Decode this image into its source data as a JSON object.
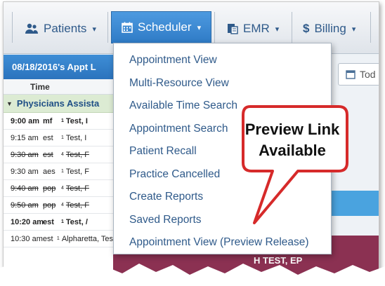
{
  "nav": {
    "items": [
      {
        "label": "Patients",
        "icon": "users-icon"
      },
      {
        "label": "Scheduler",
        "icon": "calendar-icon"
      },
      {
        "label": "EMR",
        "icon": "chart-icon"
      },
      {
        "label": "Billing",
        "icon": "dollar-icon"
      }
    ],
    "active": "Scheduler",
    "caret": "▾"
  },
  "schedule": {
    "header": "08/18/2016's Appt L",
    "column_time": "Time",
    "group": "Physicians Assista",
    "rows": [
      {
        "time": "9:00 am",
        "code": "mf",
        "sup": "1",
        "patient": "Test, I",
        "bold": true,
        "struck": false
      },
      {
        "time": "9:15 am",
        "code": "est",
        "sup": "1",
        "patient": "Test, I",
        "bold": false,
        "struck": false
      },
      {
        "time": "9:30 am",
        "code": "est",
        "sup": "4",
        "patient": "Test, F",
        "bold": false,
        "struck": true
      },
      {
        "time": "9:30 am",
        "code": "aes",
        "sup": "1",
        "patient": "Test, F",
        "bold": false,
        "struck": false
      },
      {
        "time": "9:40 am",
        "code": "pop",
        "sup": "4",
        "patient": "Test, F",
        "bold": false,
        "struck": true
      },
      {
        "time": "9:50 am",
        "code": "pop",
        "sup": "4",
        "patient": "Test, F",
        "bold": false,
        "struck": true
      },
      {
        "time": "10:20 am",
        "code": "est",
        "sup": "1",
        "patient": "Test, /",
        "bold": true,
        "struck": false
      },
      {
        "time": "10:30 am",
        "code": "est",
        "sup": "1",
        "patient": "Alpharetta, Tes",
        "bold": false,
        "struck": false
      }
    ]
  },
  "scheduler_menu": {
    "items": [
      "Appointment View",
      "Multi-Resource View",
      "Available Time Search",
      "Appointment Search",
      "Patient Recall",
      "Practice Cancelled",
      "Create Reports",
      "Saved Reports",
      "Appointment View (Preview Release)"
    ]
  },
  "today_button": {
    "label": "Tod",
    "icon": "calendar-icon"
  },
  "background_entry": "H TEST, EP",
  "callout": {
    "line1": "Preview Link",
    "line2": "Available"
  },
  "colors": {
    "nav_active": "#3a87d2",
    "link": "#2f5a8a",
    "schedule_header": "#3580c9",
    "group_row": "#dcebd3",
    "callout_border": "#d62a2a",
    "maroon": "#8b3152"
  }
}
